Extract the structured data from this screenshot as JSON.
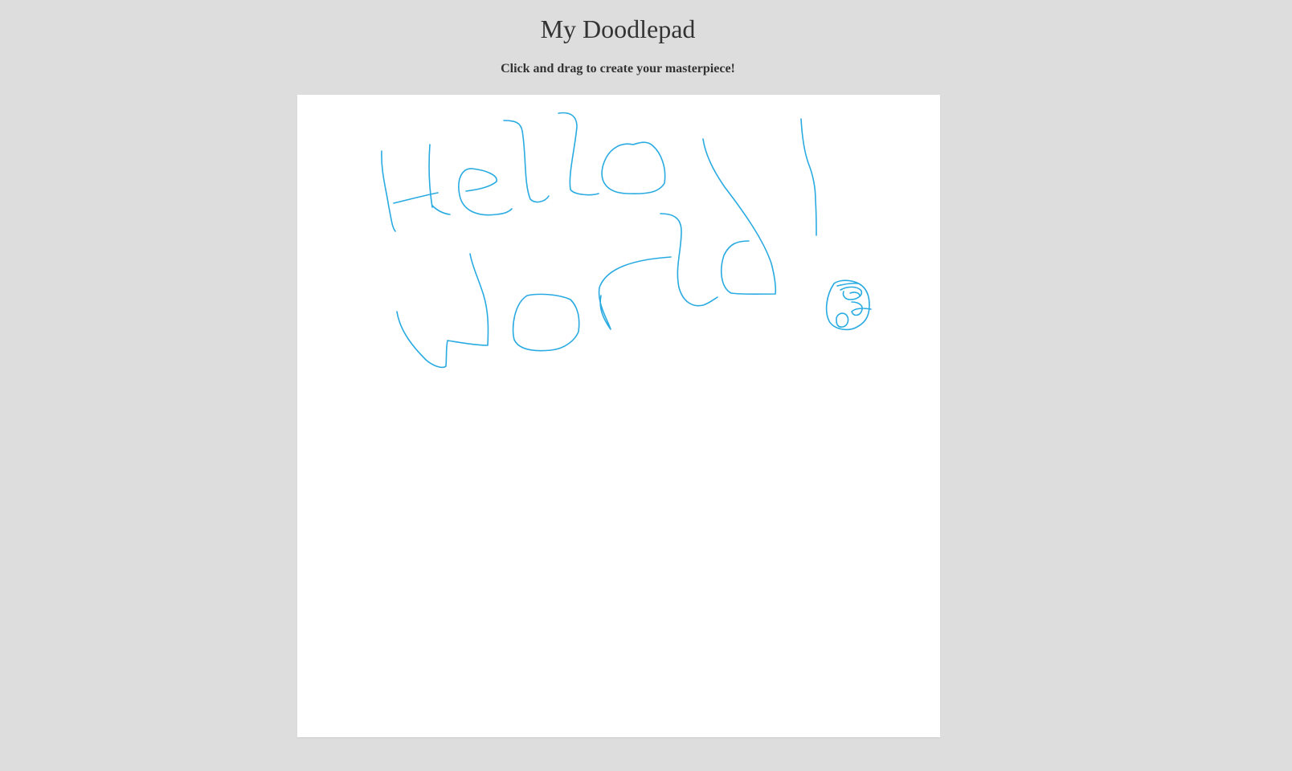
{
  "page": {
    "title": "My Doodlepad",
    "subtitle": "Click and drag to create your masterpiece!"
  },
  "canvas": {
    "background": "#ffffff",
    "stroke_color": "#29abe2"
  }
}
